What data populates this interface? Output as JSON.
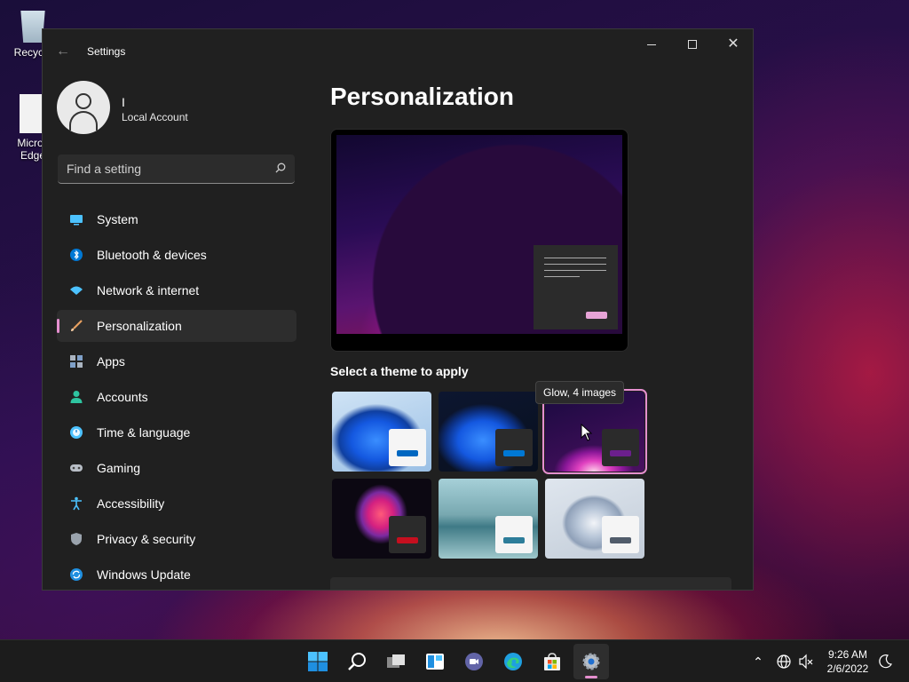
{
  "desktop": {
    "recycle_label": "Recycle",
    "edge_label_line1": "Micros",
    "edge_label_line2": "Edge"
  },
  "window": {
    "title": "Settings",
    "back_icon": "back-arrow-icon"
  },
  "profile": {
    "name": "I",
    "account_type": "Local Account"
  },
  "search": {
    "placeholder": "Find a setting"
  },
  "nav": {
    "items": [
      {
        "label": "System",
        "icon": "system-icon",
        "active": false
      },
      {
        "label": "Bluetooth & devices",
        "icon": "bluetooth-icon",
        "active": false
      },
      {
        "label": "Network & internet",
        "icon": "wifi-icon",
        "active": false
      },
      {
        "label": "Personalization",
        "icon": "brush-icon",
        "active": true
      },
      {
        "label": "Apps",
        "icon": "apps-icon",
        "active": false
      },
      {
        "label": "Accounts",
        "icon": "person-icon",
        "active": false
      },
      {
        "label": "Time & language",
        "icon": "globe-clock-icon",
        "active": false
      },
      {
        "label": "Gaming",
        "icon": "gamepad-icon",
        "active": false
      },
      {
        "label": "Accessibility",
        "icon": "accessibility-icon",
        "active": false
      },
      {
        "label": "Privacy & security",
        "icon": "shield-icon",
        "active": false
      },
      {
        "label": "Windows Update",
        "icon": "update-icon",
        "active": false
      }
    ]
  },
  "main": {
    "title": "Personalization",
    "themes_heading": "Select a theme to apply",
    "tooltip": "Glow, 4 images",
    "themes": [
      {
        "name": "windows-light",
        "accent": "#0067c0",
        "selected": false
      },
      {
        "name": "windows-dark",
        "accent": "#0078d4",
        "selected": false
      },
      {
        "name": "glow",
        "accent": "#6b1f8c",
        "selected": true
      },
      {
        "name": "captured-motion",
        "accent": "#c50f1f",
        "selected": false
      },
      {
        "name": "flow",
        "accent": "#2d7d9a",
        "selected": false
      },
      {
        "name": "sunrise",
        "accent": "#515c6b",
        "selected": false
      }
    ]
  },
  "taskbar": {
    "apps": [
      {
        "name": "start",
        "icon": "windows-logo-icon"
      },
      {
        "name": "search",
        "icon": "search-icon"
      },
      {
        "name": "task-view",
        "icon": "task-view-icon"
      },
      {
        "name": "widgets",
        "icon": "widgets-icon"
      },
      {
        "name": "chat",
        "icon": "teams-chat-icon"
      },
      {
        "name": "edge",
        "icon": "edge-icon"
      },
      {
        "name": "store",
        "icon": "store-icon"
      },
      {
        "name": "settings",
        "icon": "gear-icon"
      }
    ],
    "time": "9:26 AM",
    "date": "2/6/2022"
  },
  "colors": {
    "accent": "#e58fcf",
    "window_bg": "#202020",
    "taskbar_bg": "#1c1c1c"
  }
}
